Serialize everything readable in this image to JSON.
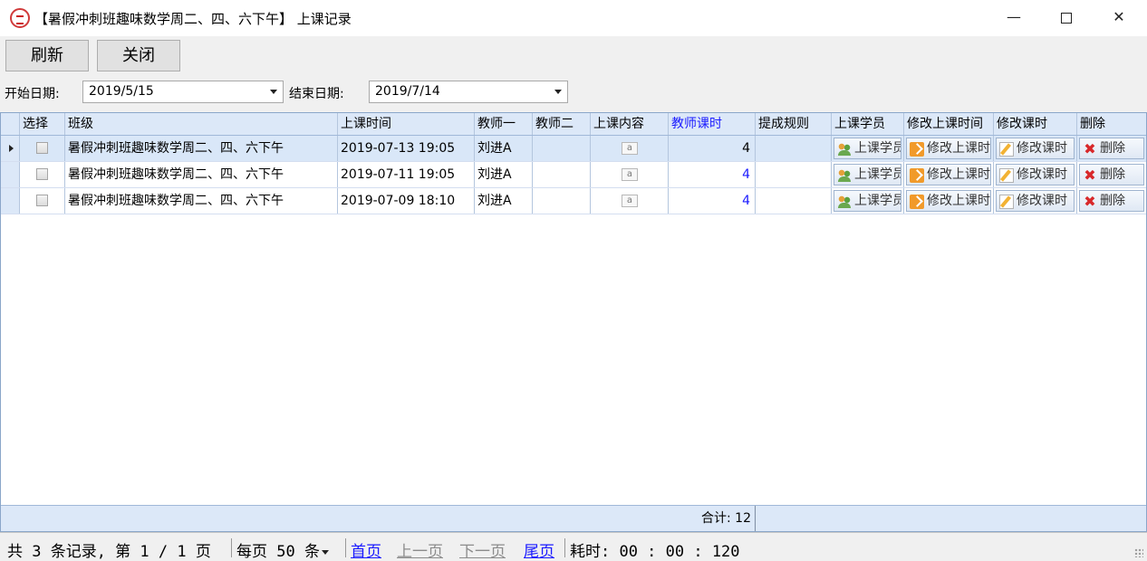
{
  "window": {
    "title": "【暑假冲刺班趣味数学周二、四、六下午】 上课记录",
    "minimize": "—",
    "close": "✕"
  },
  "toolbar": {
    "refresh_label": "刷新",
    "close_label": "关闭"
  },
  "filters": {
    "start_label": "开始日期:",
    "start_value": "2019/5/15",
    "end_label": "结束日期:",
    "end_value": "2019/7/14"
  },
  "grid": {
    "columns": [
      "选择",
      "班级",
      "上课时间",
      "教师一",
      "教师二",
      "上课内容",
      "教师课时",
      "提成规则",
      "上课学员",
      "修改上课时间",
      "修改课时",
      "删除"
    ],
    "rows": [
      {
        "class": "暑假冲刺班趣味数学周二、四、六下午",
        "time": "2019-07-13 19:05",
        "teacher1": "刘进A",
        "teacher2": "",
        "content_icon": "a",
        "hours": "4",
        "rule": "",
        "students_btn": "上课学员",
        "modify_time_btn": "修改上课时间",
        "modify_hours_btn": "修改课时",
        "delete_btn": "删除"
      },
      {
        "class": "暑假冲刺班趣味数学周二、四、六下午",
        "time": "2019-07-11 19:05",
        "teacher1": "刘进A",
        "teacher2": "",
        "content_icon": "a",
        "hours": "4",
        "rule": "",
        "students_btn": "上课学员",
        "modify_time_btn": "修改上课时间",
        "modify_hours_btn": "修改课时",
        "delete_btn": "删除"
      },
      {
        "class": "暑假冲刺班趣味数学周二、四、六下午",
        "time": "2019-07-09 18:10",
        "teacher1": "刘进A",
        "teacher2": "",
        "content_icon": "a",
        "hours": "4",
        "rule": "",
        "students_btn": "上课学员",
        "modify_time_btn": "修改上课时间",
        "modify_hours_btn": "修改课时",
        "delete_btn": "删除"
      }
    ],
    "summary": "合计: 12"
  },
  "status": {
    "records": "共 3 条记录, 第 1 / 1 页",
    "page_size": "每页 50 条",
    "first": "首页",
    "prev": "上一页",
    "next": "下一页",
    "last": "尾页",
    "elapsed": "耗时: 00 : 00 : 120"
  },
  "colors": {
    "header_bg": "#dce8f8",
    "selected_row": "#d9e7f8",
    "link_blue": "#1a1aff",
    "delete_red": "#d8282a"
  }
}
